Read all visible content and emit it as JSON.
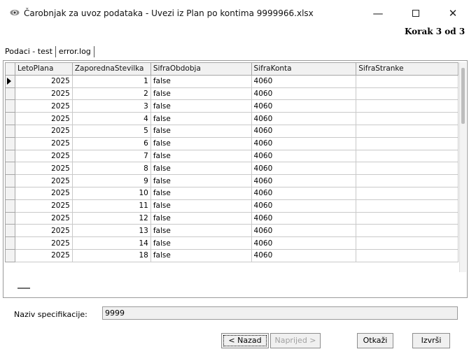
{
  "window": {
    "title": "Čarobnjak za uvoz podataka - Uvezi iz Plan po kontima 9999966.xlsx",
    "minimize_glyph": "—",
    "close_glyph": "✕",
    "step": "Korak 3 od 3"
  },
  "tabs": [
    {
      "label": "Podaci - test",
      "active": true
    },
    {
      "label": "error.log",
      "active": false
    }
  ],
  "grid": {
    "columns": [
      "LetoPlana",
      "ZaporednaStevilka",
      "SifraObdobja",
      "SifraKonta",
      "SifraStranke"
    ],
    "rows": [
      [
        "2025",
        "1",
        "false",
        "4060",
        ""
      ],
      [
        "2025",
        "2",
        "false",
        "4060",
        ""
      ],
      [
        "2025",
        "3",
        "false",
        "4060",
        ""
      ],
      [
        "2025",
        "4",
        "false",
        "4060",
        ""
      ],
      [
        "2025",
        "5",
        "false",
        "4060",
        ""
      ],
      [
        "2025",
        "6",
        "false",
        "4060",
        ""
      ],
      [
        "2025",
        "7",
        "false",
        "4060",
        ""
      ],
      [
        "2025",
        "8",
        "false",
        "4060",
        ""
      ],
      [
        "2025",
        "9",
        "false",
        "4060",
        ""
      ],
      [
        "2025",
        "10",
        "false",
        "4060",
        ""
      ],
      [
        "2025",
        "11",
        "false",
        "4060",
        ""
      ],
      [
        "2025",
        "12",
        "false",
        "4060",
        ""
      ],
      [
        "2025",
        "13",
        "false",
        "4060",
        ""
      ],
      [
        "2025",
        "14",
        "false",
        "4060",
        ""
      ],
      [
        "2025",
        "18",
        "false",
        "4060",
        ""
      ]
    ],
    "current_row": 0
  },
  "spec": {
    "label": "Naziv specifikacije:",
    "value": "9999"
  },
  "buttons": {
    "back": "< Nazad",
    "next": "Naprijed >",
    "cancel": "Otkaži",
    "finish": "Izvrši"
  },
  "colors": {
    "disabled_text": "#a0a0a0",
    "header_bg": "#f1f1f1"
  }
}
